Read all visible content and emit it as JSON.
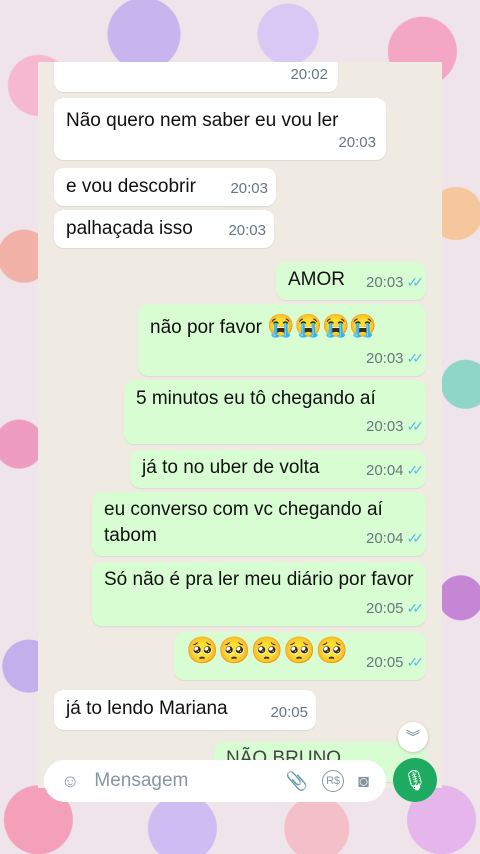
{
  "messages": [
    {
      "text": "",
      "time": "20:02",
      "dir": "in"
    },
    {
      "text": "Não quero nem saber eu vou ler",
      "time": "20:03",
      "dir": "in"
    },
    {
      "text": "e vou descobrir",
      "time": "20:03",
      "dir": "in"
    },
    {
      "text": "palhaçada isso",
      "time": "20:03",
      "dir": "in"
    },
    {
      "text": "AMOR",
      "time": "20:03",
      "dir": "out"
    },
    {
      "text": "não por favor",
      "emoji": "😭😭😭😭",
      "time": "20:03",
      "dir": "out"
    },
    {
      "text": "5 minutos eu tô chegando aí",
      "time": "20:03",
      "dir": "out"
    },
    {
      "text": "já to no uber de volta",
      "time": "20:04",
      "dir": "out"
    },
    {
      "text": "eu converso com vc chegando aí tabom",
      "time": "20:04",
      "dir": "out"
    },
    {
      "text": "Só não é pra ler meu diário por favor",
      "time": "20:05",
      "dir": "out"
    },
    {
      "text": "",
      "emoji": "🥺🥺🥺🥺🥺",
      "time": "20:05",
      "dir": "out"
    },
    {
      "text": "já to lendo Mariana",
      "time": "20:05",
      "dir": "in"
    },
    {
      "text": "NÃO BRUNO",
      "time": "",
      "dir": "out"
    }
  ],
  "ticks": "✓✓",
  "composer": {
    "placeholder": "Mensagem"
  },
  "icons": {
    "emoji": "smiley-icon",
    "attach": "paperclip-icon",
    "payment": "payment-icon",
    "camera": "camera-icon",
    "mic": "microphone-icon",
    "scroll": "double-chevron-down-icon"
  },
  "colors": {
    "incoming": "#ffffff",
    "outgoing": "#d9fdd3",
    "ticks": "#53bdeb",
    "mic": "#1daa61"
  }
}
